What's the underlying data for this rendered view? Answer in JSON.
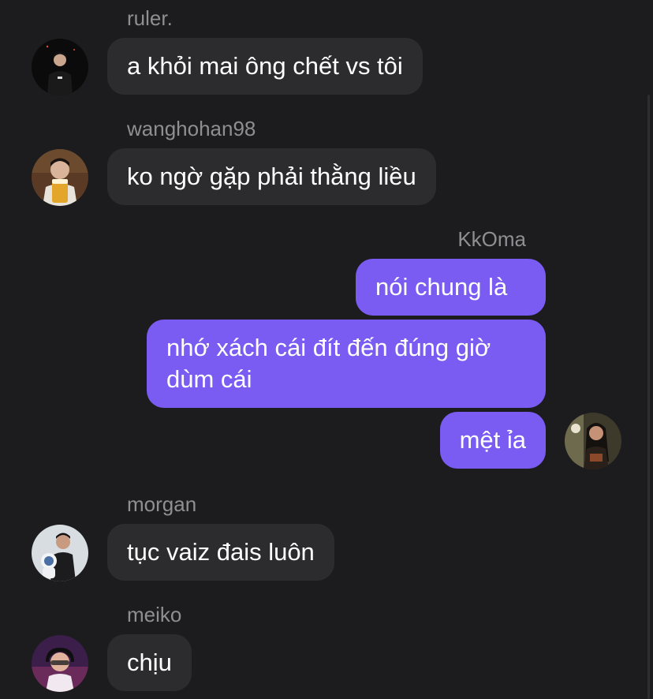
{
  "messages": [
    {
      "sender": "ruler.",
      "text": "a khỏi mai ông chết vs tôi",
      "direction": "incoming",
      "avatar_icon": "person-dark-outfit-avatar"
    },
    {
      "sender": "wanghohan98",
      "text": "ko ngờ gặp phải thằng liều",
      "direction": "incoming",
      "avatar_icon": "person-with-beer-avatar"
    },
    {
      "sender": "KkOma",
      "direction": "outgoing",
      "bubbles": [
        "nói chung là",
        "nhớ xách cái đít đến đúng giờ dùm cái",
        "mệt ỉa"
      ],
      "avatar_icon": "person-long-hair-avatar"
    },
    {
      "sender": "morgan",
      "text": "tục vaiz đais luôn",
      "direction": "incoming",
      "avatar_icon": "person-with-plush-avatar"
    },
    {
      "sender": "meiko",
      "text": "chịu",
      "direction": "incoming",
      "avatar_icon": "person-with-headset-avatar"
    }
  ],
  "colors": {
    "background": "#1c1c1e",
    "incoming_bubble": "#2c2c2e",
    "outgoing_bubble": "#7a5cf2",
    "sender_name": "#8e8e93",
    "message_text": "#ffffff"
  }
}
